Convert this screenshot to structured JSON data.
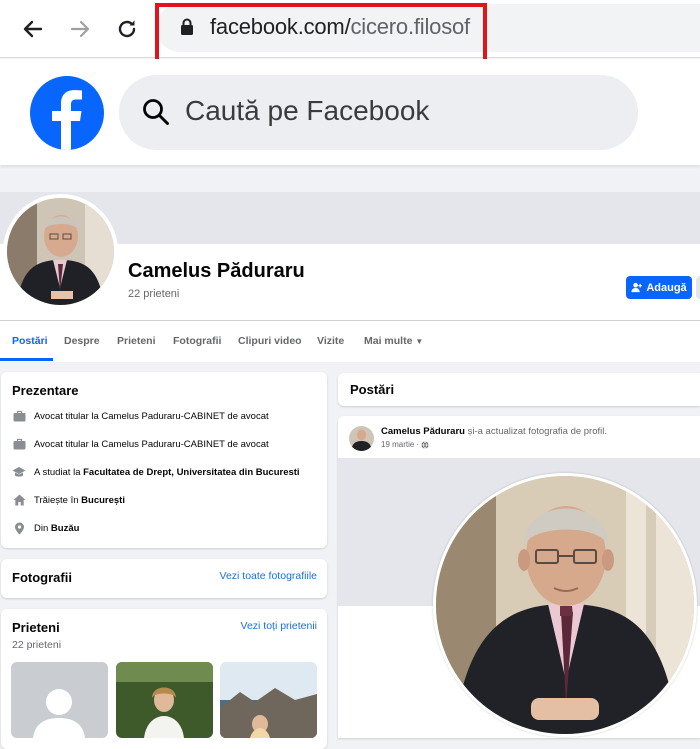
{
  "browser": {
    "url_host": "facebook.com/",
    "url_path": "cicero.filosof"
  },
  "fb_header": {
    "search_placeholder": "Caută pe Facebook"
  },
  "profile": {
    "name": "Camelus Păduraru",
    "friends_count": "22 prieteni",
    "add_button": "Adaugă"
  },
  "tabs": [
    {
      "label": "Postări",
      "active": true
    },
    {
      "label": "Despre"
    },
    {
      "label": "Prieteni"
    },
    {
      "label": "Fotografii"
    },
    {
      "label": "Clipuri video"
    },
    {
      "label": "Vizite"
    },
    {
      "label": "Mai multe"
    }
  ],
  "intro": {
    "title": "Prezentare",
    "items": [
      {
        "icon": "briefcase-icon",
        "text": "Avocat titular la Camelus Paduraru-CABINET de avocat",
        "bold": ""
      },
      {
        "icon": "briefcase-icon",
        "text": "Avocat titular la Camelus Paduraru-CABINET de avocat",
        "bold": ""
      },
      {
        "icon": "graduation-cap-icon",
        "text": "A studiat la ",
        "bold": "Facultatea de Drept, Universitatea din Bucuresti"
      },
      {
        "icon": "home-icon",
        "text": "Trăiește în ",
        "bold": "București"
      },
      {
        "icon": "location-pin-icon",
        "text": "Din ",
        "bold": "Buzău"
      }
    ]
  },
  "photos": {
    "title": "Fotografii",
    "see_all": "Vezi toate fotografiile"
  },
  "friends": {
    "title": "Prieteni",
    "count": "22 prieteni",
    "see_all": "Vezi toți prietenii"
  },
  "posts": {
    "title": "Postări",
    "author": "Camelus Păduraru",
    "action": "și-a actualizat fotografia de profil.",
    "date": "19 martie",
    "separator": "·"
  },
  "colors": {
    "fb_blue": "#0866ff",
    "highlight_red": "#e2141b",
    "link_blue": "#216fdb"
  }
}
